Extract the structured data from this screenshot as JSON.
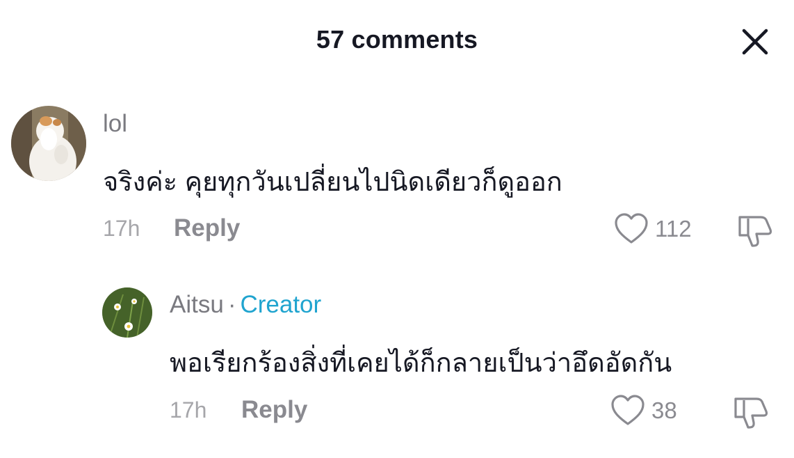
{
  "header": {
    "title": "57 comments",
    "close_icon": "close-icon"
  },
  "comments": [
    {
      "username": "lol",
      "text": "จริงค่ะ คุยทุกวันเปลี่ยนไปนิดเดียวก็ดูออก",
      "time": "17h",
      "reply_label": "Reply",
      "likes": "112",
      "avatar": "cat-avatar"
    },
    {
      "username": "Aitsu",
      "separator": "·",
      "badge": "Creator",
      "text": "พอเรียกร้องสิ่งที่เคยได้ก็กลายเป็นว่าอึดอัดกัน",
      "time": "17h",
      "reply_label": "Reply",
      "likes": "38",
      "avatar": "flower-avatar"
    }
  ],
  "colors": {
    "creator": "#20a4cf",
    "text": "#161823",
    "muted": "#8a8a90"
  }
}
